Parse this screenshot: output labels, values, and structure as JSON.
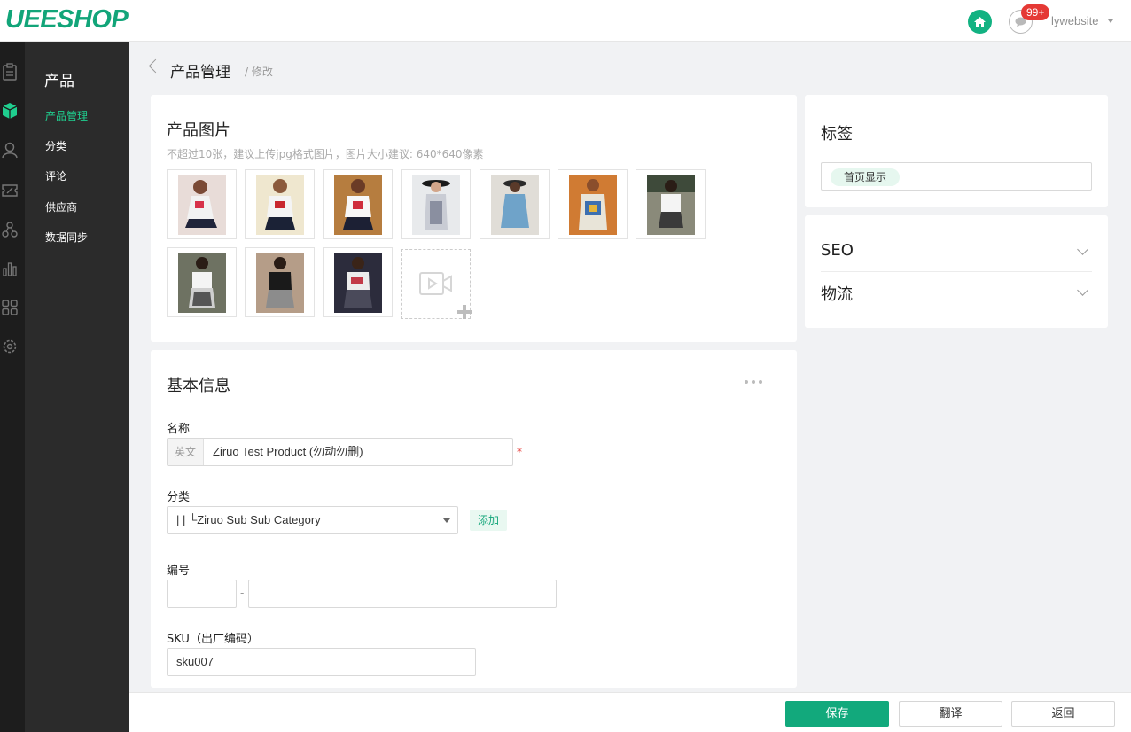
{
  "header": {
    "logo": "UEESHOP",
    "badge": "99+",
    "username": "lywebsite"
  },
  "sidebar": {
    "title": "产品",
    "items": [
      {
        "label": "产品管理",
        "active": true
      },
      {
        "label": "分类"
      },
      {
        "label": "评论"
      },
      {
        "label": "供应商"
      },
      {
        "label": "数据同步"
      }
    ],
    "rail_icons": [
      "orders-icon",
      "product-icon",
      "users-icon",
      "coupon-icon",
      "share-icon",
      "stats-icon",
      "apps-icon",
      "settings-icon"
    ]
  },
  "breadcrumb": {
    "title": "产品管理",
    "sub": "/ 修改"
  },
  "images_card": {
    "title": "产品图片",
    "hint": "不超过10张，建议上传jpg格式图片，图片大小建议: 640*640像素",
    "image_count": 10
  },
  "basic_info": {
    "title": "基本信息",
    "name_label": "名称",
    "name_lang": "英文",
    "name_value": "Ziruo Test Product (勿动勿删)",
    "required_mark": "*",
    "category_label": "分类",
    "category_value": "| | └Ziruo Sub Sub Category",
    "add_label": "添加",
    "number_label": "编号",
    "number_separator": "-",
    "sku_label": "SKU（出厂编码）",
    "sku_value": "sku007"
  },
  "tags_card": {
    "title": "标签",
    "chip": "首页显示"
  },
  "seo_card": {
    "seo": "SEO",
    "logistics": "物流"
  },
  "footer": {
    "save": "保存",
    "translate": "翻译",
    "back": "返回"
  },
  "colors": {
    "accent": "#12a97c",
    "sidebar_active": "#1fcf8f",
    "badge": "#e53935"
  }
}
